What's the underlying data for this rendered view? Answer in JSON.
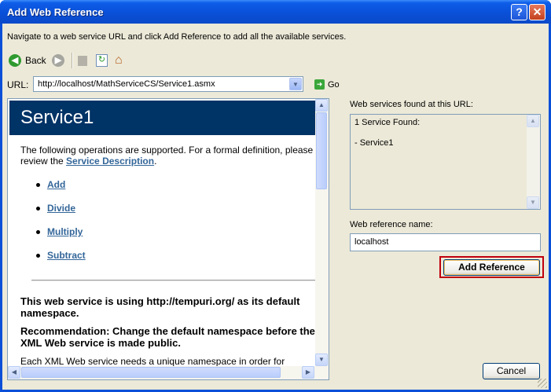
{
  "window": {
    "title": "Add Web Reference",
    "help_symbol": "?",
    "close_symbol": "✕"
  },
  "instructions": "Navigate to a web service URL and click Add Reference to add all the available services.",
  "toolbar": {
    "back_label": "Back",
    "icons": [
      "back-arrow-icon",
      "forward-arrow-icon",
      "stop-icon",
      "refresh-icon",
      "home-icon"
    ]
  },
  "url": {
    "label": "URL:",
    "value": "http://localhost/MathServiceCS/Service1.asmx",
    "go_label": "Go"
  },
  "browser": {
    "title": "Service1",
    "intro_before": "The following operations are supported. For a formal definition, please review the ",
    "intro_link": "Service Description",
    "intro_after": ".",
    "operations": [
      "Add",
      "Divide",
      "Multiply",
      "Subtract"
    ],
    "notice_1": "This web service is using http://tempuri.org/ as its default namespace.",
    "notice_2": "Recommendation: Change the default namespace before the XML Web service is made public.",
    "notice_3": "Each XML Web service needs a unique namespace in order for"
  },
  "found": {
    "label": "Web services found at this URL:",
    "count_text": "1 Service Found:",
    "items": [
      "- Service1"
    ]
  },
  "reference": {
    "label": "Web reference name:",
    "value": "localhost"
  },
  "buttons": {
    "add_reference": "Add Reference",
    "cancel": "Cancel"
  },
  "colors": {
    "title_bar": "#0a50d8",
    "service_header": "#003366",
    "link": "#336699",
    "highlight_outline": "#c0000d"
  }
}
